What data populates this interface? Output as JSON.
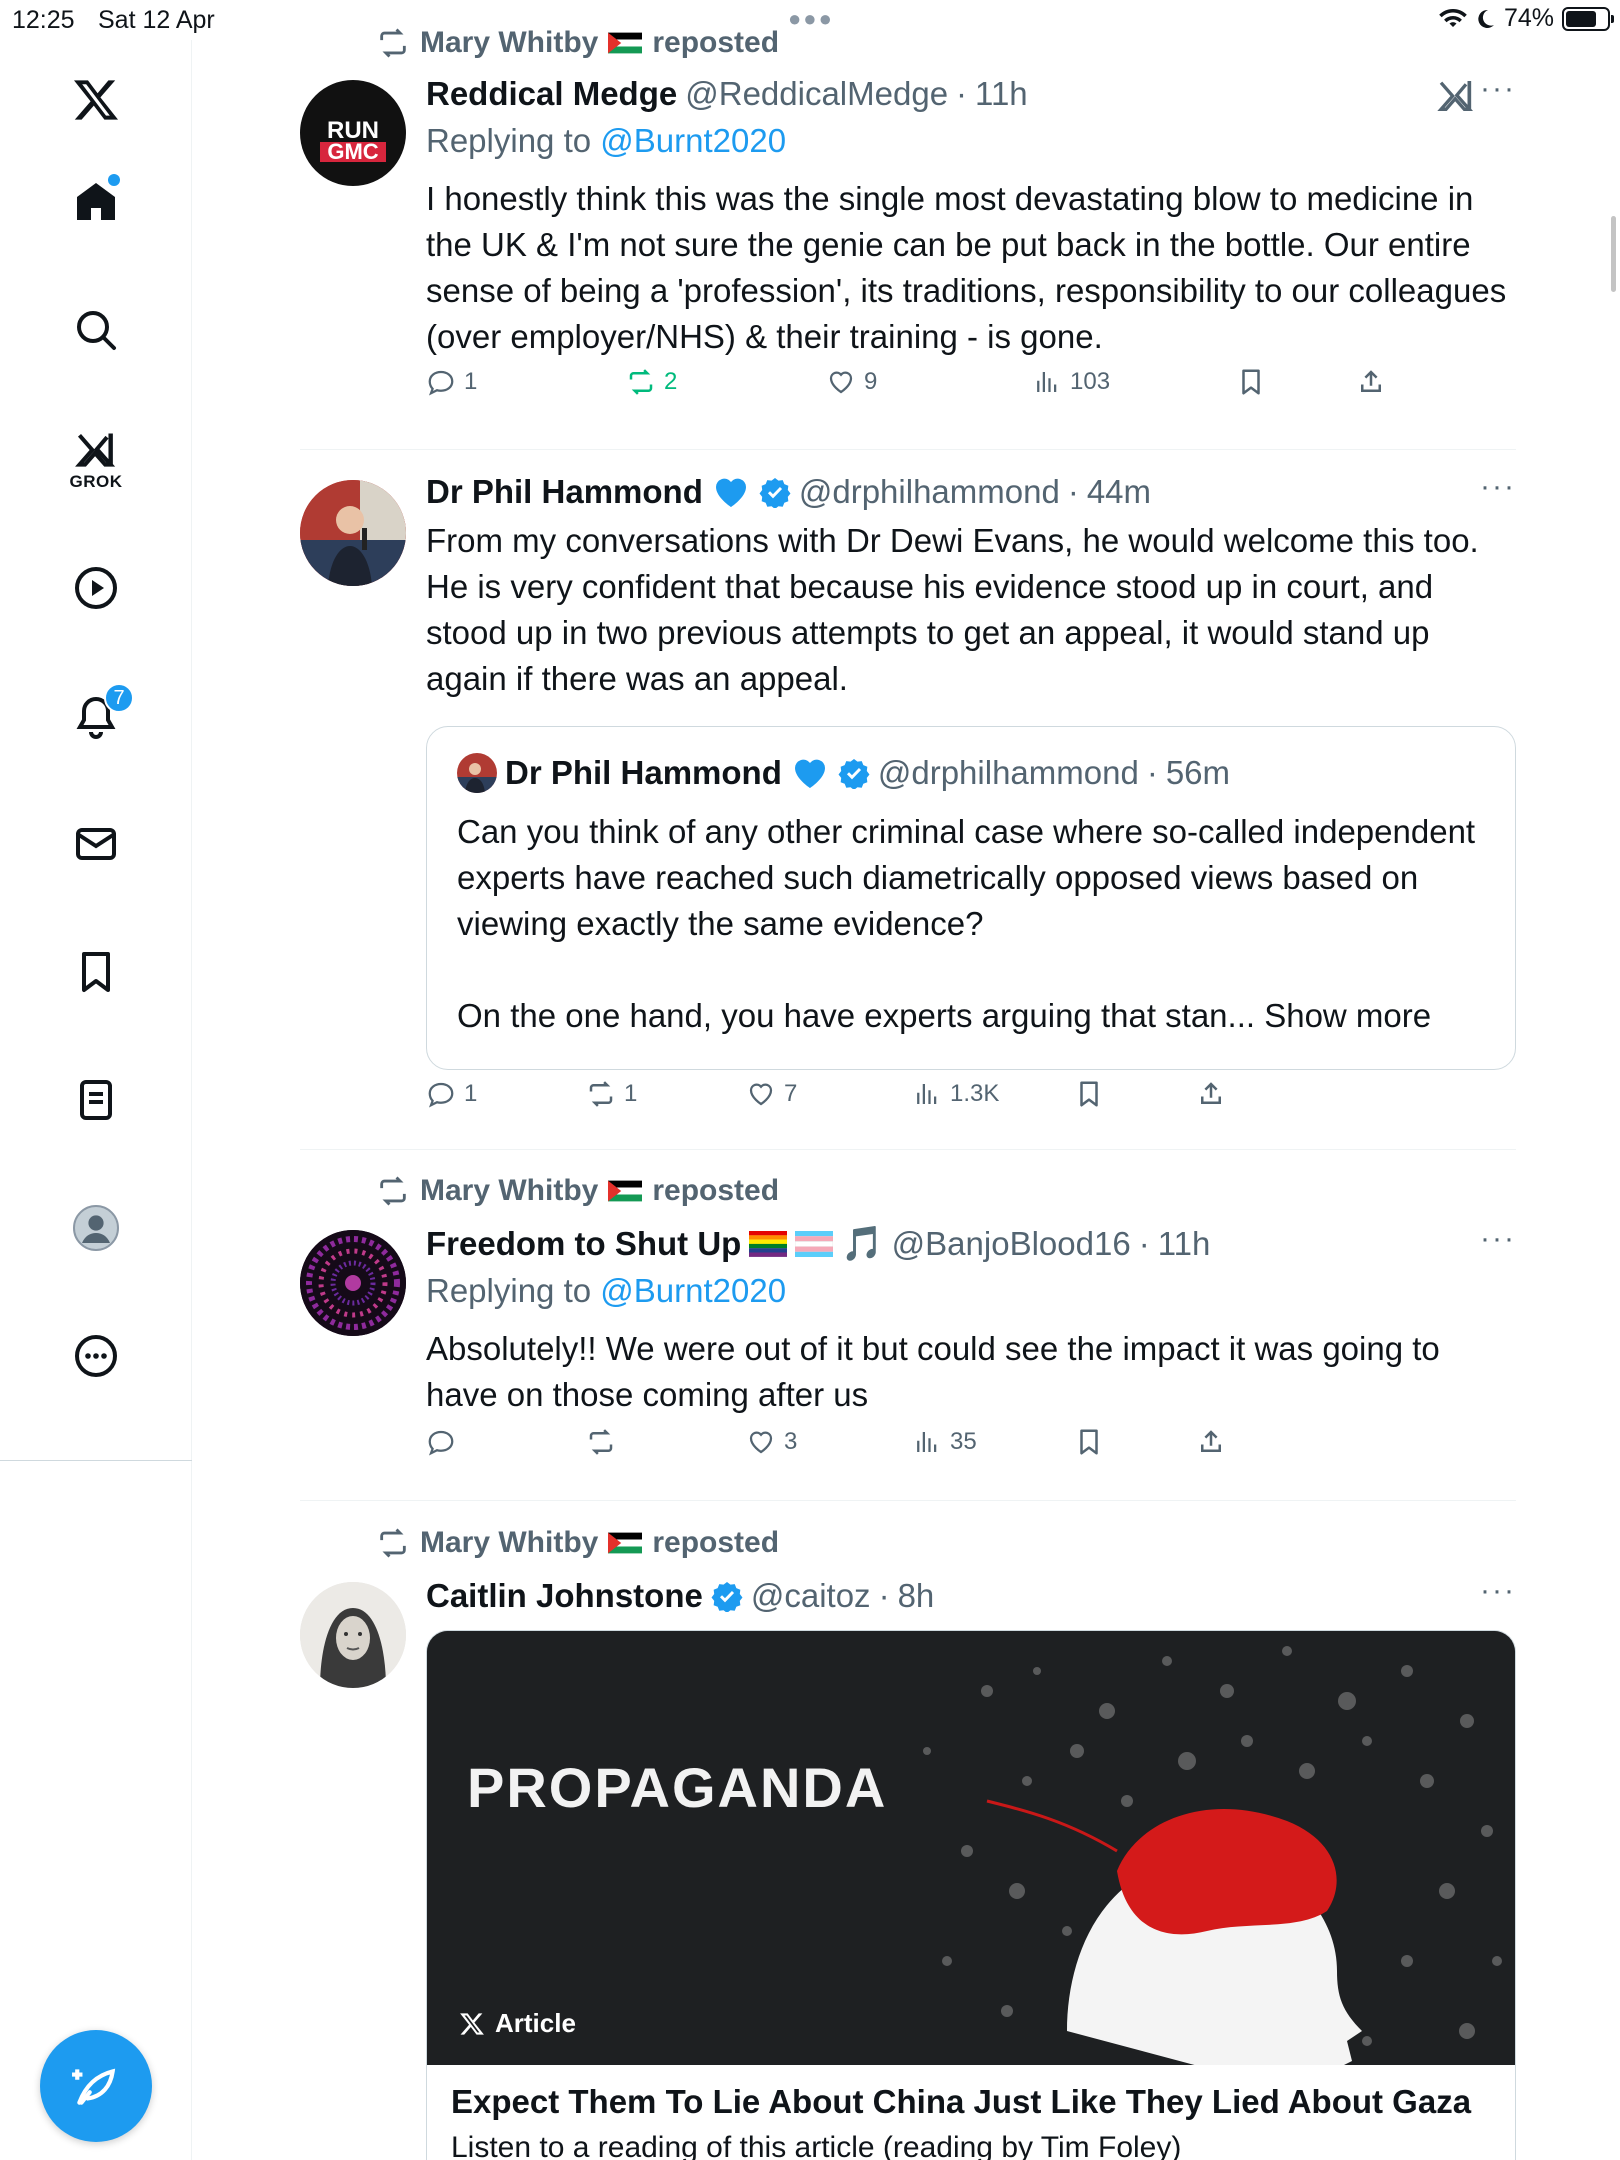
{
  "status_bar": {
    "time": "12:25",
    "date": "Sat 12 Apr",
    "battery": "74%",
    "battery_level": 0.74
  },
  "sidebar": {
    "items": [
      {
        "id": "home",
        "label": "Home"
      },
      {
        "id": "search",
        "label": "Search"
      },
      {
        "id": "grok",
        "label": "GROK"
      },
      {
        "id": "video",
        "label": "Video"
      },
      {
        "id": "notifications",
        "label": "Notifications",
        "badge": "7"
      },
      {
        "id": "messages",
        "label": "Messages"
      },
      {
        "id": "bookmarks",
        "label": "Bookmarks"
      },
      {
        "id": "lists",
        "label": "Lists"
      },
      {
        "id": "profile",
        "label": "Profile"
      },
      {
        "id": "more",
        "label": "More"
      }
    ]
  },
  "posts": [
    {
      "repost_by": "Mary Whitby",
      "repost_suffix": "reposted",
      "name": "Reddical Medge",
      "handle": "@ReddicalMedge",
      "sep": "·",
      "time": "11h",
      "replying_prefix": "Replying to",
      "replying_to": "@Burnt2020",
      "avatar_text_1": "RUN",
      "avatar_text_2": "GMC",
      "text": "I honestly think this was the single most devastating blow to medicine in the UK & I'm not sure the genie can be put back in the bottle. Our entire sense of being a 'profession', its traditions, responsibility to our colleagues (over employer/NHS) & their training - is gone.",
      "stats": {
        "replies": "1",
        "reposts": "2",
        "likes": "9",
        "views": "103"
      }
    },
    {
      "name": "Dr Phil Hammond",
      "handle": "@drphilhammond",
      "sep": "·",
      "time": "44m",
      "text": "From my conversations with Dr Dewi Evans, he would welcome this too. He is very confident that because his evidence stood up in court, and stood up in two previous attempts to get an appeal, it would stand up again if there was an appeal.",
      "quote": {
        "name": "Dr Phil Hammond",
        "handle": "@drphilhammond",
        "sep": "·",
        "time": "56m",
        "text": "Can you think of any other criminal case where so-called independent experts have reached such diametrically opposed views based on viewing exactly the same evidence?\n\nOn the one hand, you have experts arguing that stan... Show more"
      },
      "stats": {
        "replies": "1",
        "reposts": "1",
        "likes": "7",
        "views": "1.3K"
      }
    },
    {
      "repost_by": "Mary Whitby",
      "repost_suffix": "reposted",
      "name": "Freedom to Shut Up",
      "name_emoji": "🎵",
      "handle": "@BanjoBlood16",
      "sep": "·",
      "time": "11h",
      "replying_prefix": "Replying to",
      "replying_to": "@Burnt2020",
      "text": "Absolutely!! We were out of it but could see the impact it was going to have on those coming after us",
      "stats": {
        "replies": "",
        "reposts": "",
        "likes": "3",
        "views": "35"
      }
    },
    {
      "repost_by": "Mary Whitby",
      "repost_suffix": "reposted",
      "name": "Caitlin Johnstone",
      "handle": "@caitoz",
      "sep": "·",
      "time": "8h",
      "article": {
        "image_text": "PROPAGANDA",
        "badge": "Article",
        "title": "Expect Them To Lie About China Just Like They Lied About Gaza",
        "subtitle": "Listen to a reading of this article (reading by Tim Foley)"
      }
    }
  ],
  "colors": {
    "accent": "#1d9bf0",
    "green": "#00ba7c",
    "muted": "#536471",
    "text": "#0f1419"
  }
}
